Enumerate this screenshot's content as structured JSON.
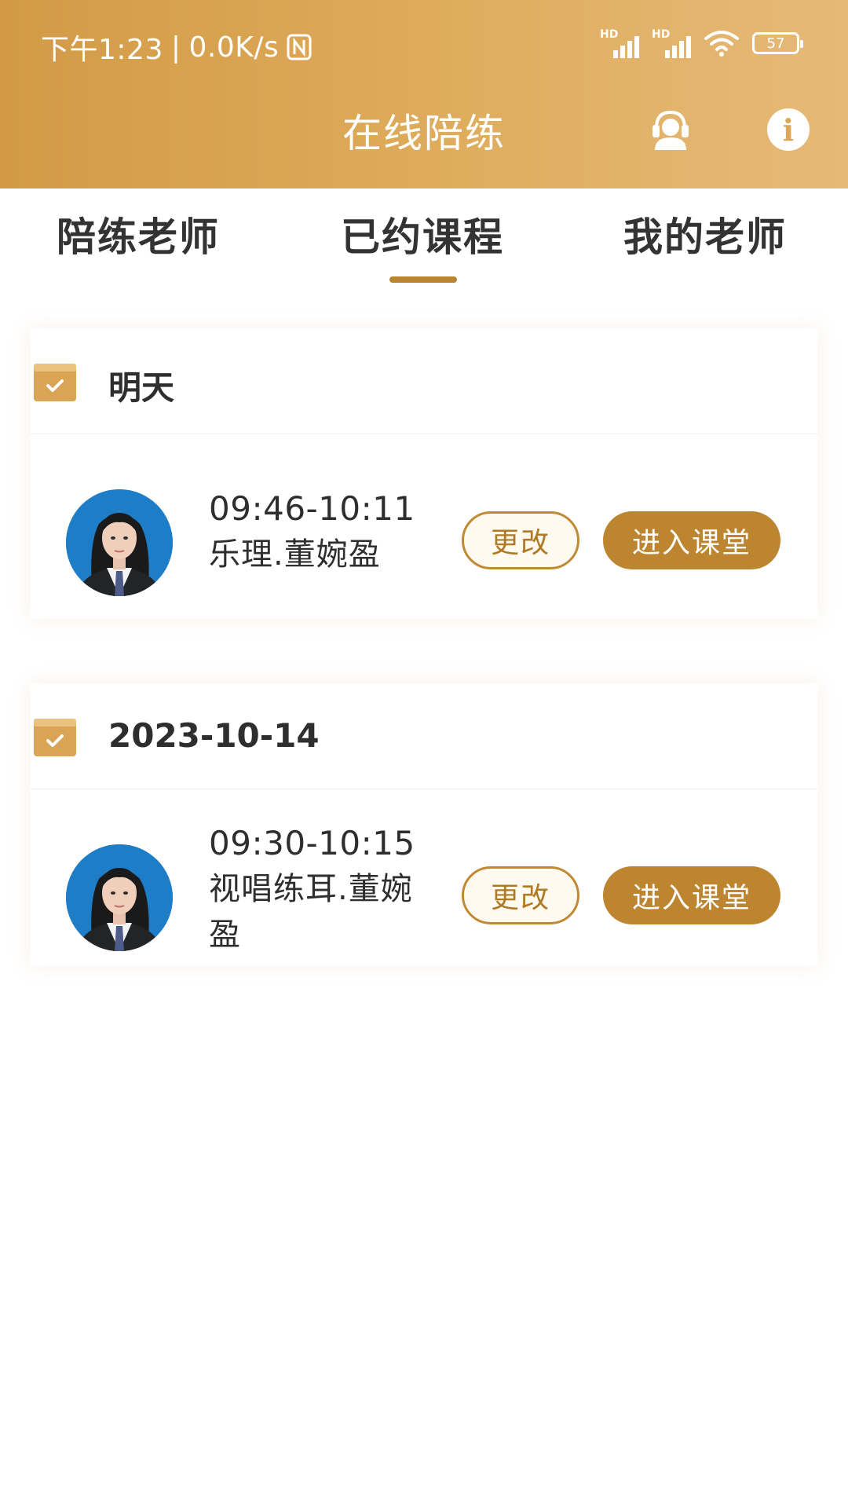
{
  "status_bar": {
    "time": "下午1:23",
    "network_speed": "0.0K/s",
    "battery": "57",
    "nfc_icon": "nfc-icon",
    "signal_label": "HD"
  },
  "header": {
    "title": "在线陪练",
    "support_icon": "customer-service-icon",
    "info_icon": "info-icon",
    "background_colors": [
      "#d29a45",
      "#e6b978"
    ]
  },
  "tabs": [
    {
      "label": "陪练老师",
      "selected": false
    },
    {
      "label": "已约课程",
      "selected": true
    },
    {
      "label": "我的老师",
      "selected": false
    }
  ],
  "accent_color": "#bd8530",
  "schedule": [
    {
      "date": "明天",
      "lessons": [
        {
          "time": "09:46-10:11",
          "name": "乐理.董婉盈",
          "change_label": "更改",
          "enter_label": "进入课堂"
        }
      ]
    },
    {
      "date": "2023-10-14",
      "lessons": [
        {
          "time": "09:30-10:15",
          "name": "视唱练耳.董婉盈",
          "change_label": "更改",
          "enter_label": "进入课堂"
        }
      ]
    }
  ]
}
